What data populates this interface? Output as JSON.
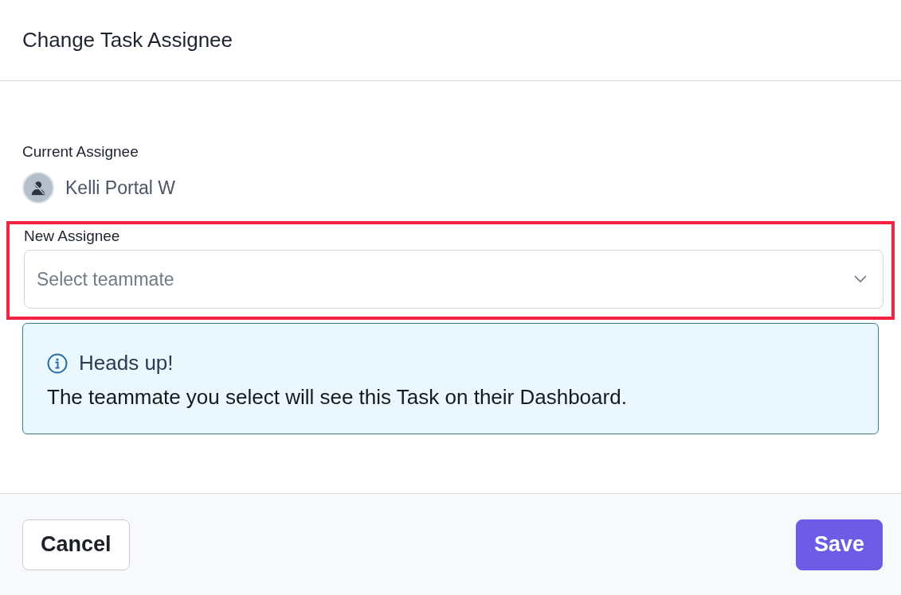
{
  "dialog": {
    "title": "Change Task Assignee"
  },
  "current_assignee": {
    "label": "Current Assignee",
    "name": "Kelli Portal W"
  },
  "new_assignee": {
    "label": "New Assignee",
    "placeholder": "Select teammate",
    "highlighted": true
  },
  "alert": {
    "title": "Heads up!",
    "message": "The teammate you select will see this Task on their Dashboard."
  },
  "buttons": [
    {
      "label": "Cancel",
      "kind": "secondary"
    },
    {
      "label": "Save",
      "kind": "primary"
    }
  ]
}
